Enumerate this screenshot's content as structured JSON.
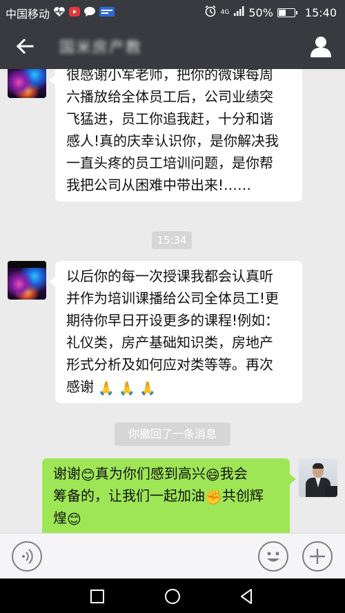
{
  "status_bar": {
    "carrier": "中国移动",
    "network": "4G",
    "battery_percent_text": "50%",
    "battery_level": 0.5,
    "time": "15:40"
  },
  "header": {
    "title": "国米房产教",
    "back_icon": "back-arrow-icon",
    "profile_icon": "person-icon"
  },
  "messages": [
    {
      "side": "left",
      "lines": [
        "很感谢小军老师，把你的微课每周",
        "六播放给全体员工后，公司业绩突",
        "飞猛进，员工你追我赶，十分和谐",
        "感人!真的庆幸认识你，是你解决我",
        "一直头疼的员工培训问题，是你帮",
        "我把公司从困难中带出来!……"
      ]
    },
    {
      "side": "left",
      "lines": [
        "以后你的每一次授课我都会认真听",
        "并作为培训课播给公司全体员工!更",
        "期待你早日开设更多的课程!例如：",
        "礼仪类，房产基础知识类，房地产",
        "形式分析及如何应对类等等。再次",
        "感谢"
      ],
      "emojis": [
        "🙏",
        "🙏",
        "🙏"
      ]
    },
    {
      "side": "right",
      "line1_parts": [
        "谢谢",
        "真为你们感到高兴",
        "我会"
      ],
      "line2_parts": [
        "筹备的，让我们一起加油",
        "共创辉"
      ],
      "line3_parts": [
        "煌"
      ],
      "emojis": [
        "😊",
        "😄",
        "✊",
        "😊"
      ]
    }
  ],
  "time_divider": "15:34",
  "recall_notice": "你撤回了一条消息",
  "input_bar": {
    "voice_icon": "voice-icon",
    "emoji_icon": "emoji-face-icon",
    "plus_icon": "plus-icon"
  },
  "colors": {
    "header_bg": "#393a3f",
    "chat_bg": "#ebebeb",
    "own_bubble": "#9ee656",
    "other_bubble": "#ffffff"
  }
}
